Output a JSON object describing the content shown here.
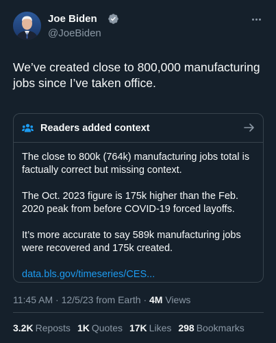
{
  "author": {
    "name": "Joe Biden",
    "handle": "@JoeBiden",
    "verified_color": "#8b98a5"
  },
  "tweet": {
    "text": "We’ve created close to 800,000 manufacturing jobs since I’ve taken office."
  },
  "context": {
    "title": "Readers added context",
    "paragraphs": [
      "The close to 800k (764k) manufacturing jobs total is factually correct but missing context.",
      "The Oct. 2023 figure is 175k higher than the Feb. 2020 peak from before COVID-19 forced layoffs.",
      "It’s more accurate to say 589k manufacturing jobs were recovered and 175k created."
    ],
    "link": "data.bls.gov/timeseries/CES..."
  },
  "meta": {
    "time": "11:45 AM",
    "date": "12/5/23",
    "source": "from Earth",
    "views_count": "4M",
    "views_label": "Views"
  },
  "stats": {
    "reposts": {
      "count": "3.2K",
      "label": "Reposts"
    },
    "quotes": {
      "count": "1K",
      "label": "Quotes"
    },
    "likes": {
      "count": "17K",
      "label": "Likes"
    },
    "bookmarks": {
      "count": "298",
      "label": "Bookmarks"
    }
  },
  "colors": {
    "background": "#15202b",
    "accent": "#1d9bf0",
    "secondary_text": "#8b98a5",
    "border": "#38444d"
  },
  "icons": [
    "verified-badge-icon",
    "more-icon",
    "people-icon",
    "arrow-right-icon"
  ]
}
